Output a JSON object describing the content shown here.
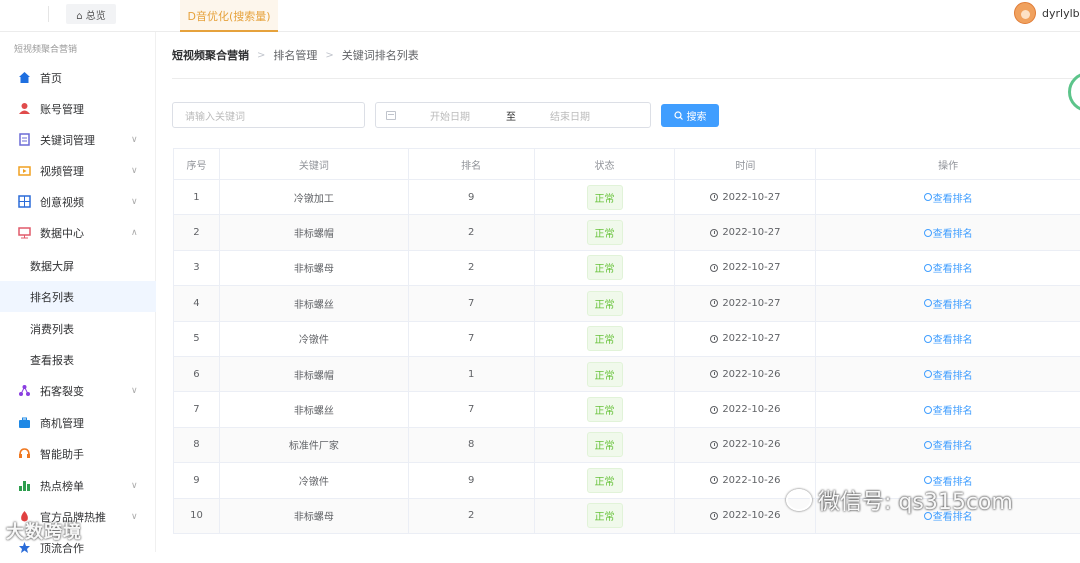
{
  "topbar": {
    "home_tab": "⌂ 总览",
    "active_tab": "D音优化(搜索量)",
    "username": "dyrlylb"
  },
  "sidebar": {
    "title": "短视频聚合营销",
    "items": [
      {
        "label": "首页",
        "icon": "home-icon",
        "color": "#1e6fe0"
      },
      {
        "label": "账号管理",
        "icon": "user-icon",
        "color": "#e04b4b"
      },
      {
        "label": "关键词管理",
        "icon": "document-icon",
        "color": "#6b6bd6",
        "chevron": "∨"
      },
      {
        "label": "视频管理",
        "icon": "video-icon",
        "color": "#f0a020",
        "chevron": "∨"
      },
      {
        "label": "创意视频",
        "icon": "grid-icon",
        "color": "#2b6cd8",
        "chevron": "∨"
      },
      {
        "label": "数据中心",
        "icon": "screen-icon",
        "color": "#e05a6a",
        "chevron": "∧"
      }
    ],
    "sub_items": [
      "数据大屏",
      "排名列表",
      "消费列表",
      "查看报表"
    ],
    "items_after": [
      {
        "label": "拓客裂变",
        "icon": "split-icon",
        "color": "#8a3fe0",
        "chevron": "∨"
      },
      {
        "label": "商机管理",
        "icon": "briefcase-icon",
        "color": "#1e88e5"
      },
      {
        "label": "智能助手",
        "icon": "headset-icon",
        "color": "#f07820"
      },
      {
        "label": "热点榜单",
        "icon": "bar-chart-icon",
        "color": "#2e9e4e",
        "chevron": "∨"
      },
      {
        "label": "官方品牌热推",
        "icon": "fire-icon",
        "color": "#e04040",
        "chevron": "∨"
      },
      {
        "label": "顶流合作",
        "icon": "star-icon",
        "color": "#2b6cd8"
      }
    ]
  },
  "breadcrumb": {
    "root": "短视频聚合营销",
    "level2": "排名管理",
    "level3": "关键词排名列表",
    "sep": ">"
  },
  "filters": {
    "keyword_placeholder": "请输入关键词",
    "start_placeholder": "开始日期",
    "to_label": "至",
    "end_placeholder": "结束日期",
    "search_label": "搜索"
  },
  "table": {
    "headers": [
      "序号",
      "关键词",
      "排名",
      "状态",
      "时间",
      "操作"
    ],
    "rows": [
      {
        "idx": "1",
        "keyword": "冷镦加工",
        "rank": "9",
        "status": "正常",
        "time": "2022-10-27",
        "action": "查看排名"
      },
      {
        "idx": "2",
        "keyword": "非标螺帽",
        "rank": "2",
        "status": "正常",
        "time": "2022-10-27",
        "action": "查看排名"
      },
      {
        "idx": "3",
        "keyword": "非标螺母",
        "rank": "2",
        "status": "正常",
        "time": "2022-10-27",
        "action": "查看排名"
      },
      {
        "idx": "4",
        "keyword": "非标螺丝",
        "rank": "7",
        "status": "正常",
        "time": "2022-10-27",
        "action": "查看排名"
      },
      {
        "idx": "5",
        "keyword": "冷镦件",
        "rank": "7",
        "status": "正常",
        "time": "2022-10-27",
        "action": "查看排名"
      },
      {
        "idx": "6",
        "keyword": "非标螺帽",
        "rank": "1",
        "status": "正常",
        "time": "2022-10-26",
        "action": "查看排名"
      },
      {
        "idx": "7",
        "keyword": "非标螺丝",
        "rank": "7",
        "status": "正常",
        "time": "2022-10-26",
        "action": "查看排名"
      },
      {
        "idx": "8",
        "keyword": "标准件厂家",
        "rank": "8",
        "status": "正常",
        "time": "2022-10-26",
        "action": "查看排名"
      },
      {
        "idx": "9",
        "keyword": "冷镦件",
        "rank": "9",
        "status": "正常",
        "time": "2022-10-26",
        "action": "查看排名"
      },
      {
        "idx": "10",
        "keyword": "非标螺母",
        "rank": "2",
        "status": "正常",
        "time": "2022-10-26",
        "action": "查看排名"
      }
    ]
  },
  "watermarks": {
    "left": "大数跨境",
    "right": "微信号: qs315com"
  }
}
